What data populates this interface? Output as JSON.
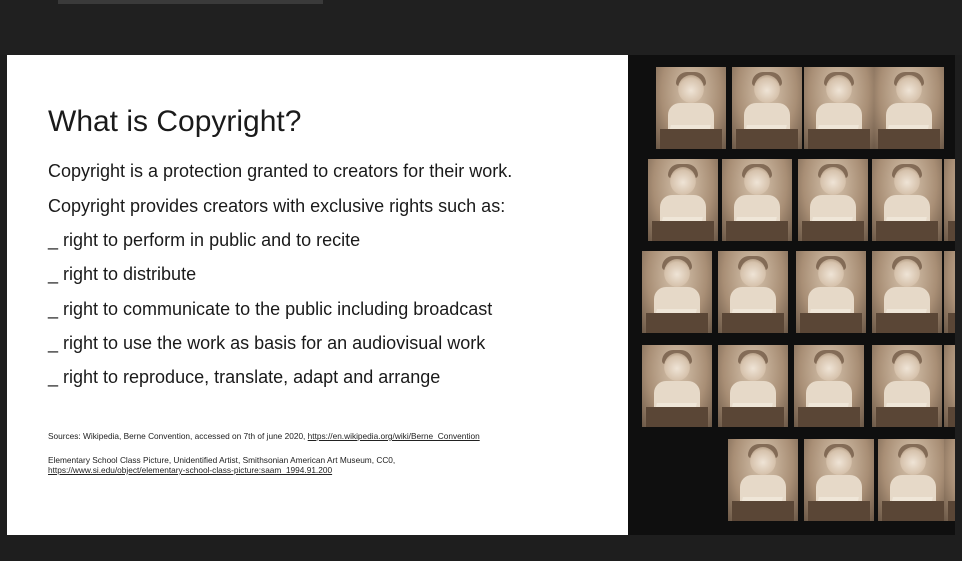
{
  "slide": {
    "title": "What is Copyright?",
    "lines": [
      "Copyright is a protection granted to creators for their work.",
      "Copyright provides creators with exclusive rights such as:",
      "_ right to perform in public and to recite",
      "_ right to distribute",
      "_ right to communicate to the public including broadcast",
      "_ right to use the work as basis for an audiovisual work",
      "_ right to reproduce, translate, adapt and arrange"
    ],
    "sources": {
      "line1_text": "Sources: Wikipedia, Berne Convention, accessed on 7th of june 2020, ",
      "line1_link": "https://en.wikipedia.org/wiki/Berne_Convention",
      "line2_text": "Elementary School Class Picture, Unidentified Artist, Smithsonian American Art Museum, CC0,",
      "line3_link": "https://www.si.edu/object/elementary-school-class-picture:saam_1994.91.200"
    }
  },
  "photo_panel": {
    "description_icon": "class-photo-contact-sheet",
    "colors": {
      "sepia_light": "#cdbaa4",
      "sepia_dark": "#6b5847",
      "background": "#0f0f0f"
    }
  },
  "colors": {
    "page_background": "#1e1e1e",
    "slide_background": "#ffffff",
    "text": "#1a1a1a"
  }
}
